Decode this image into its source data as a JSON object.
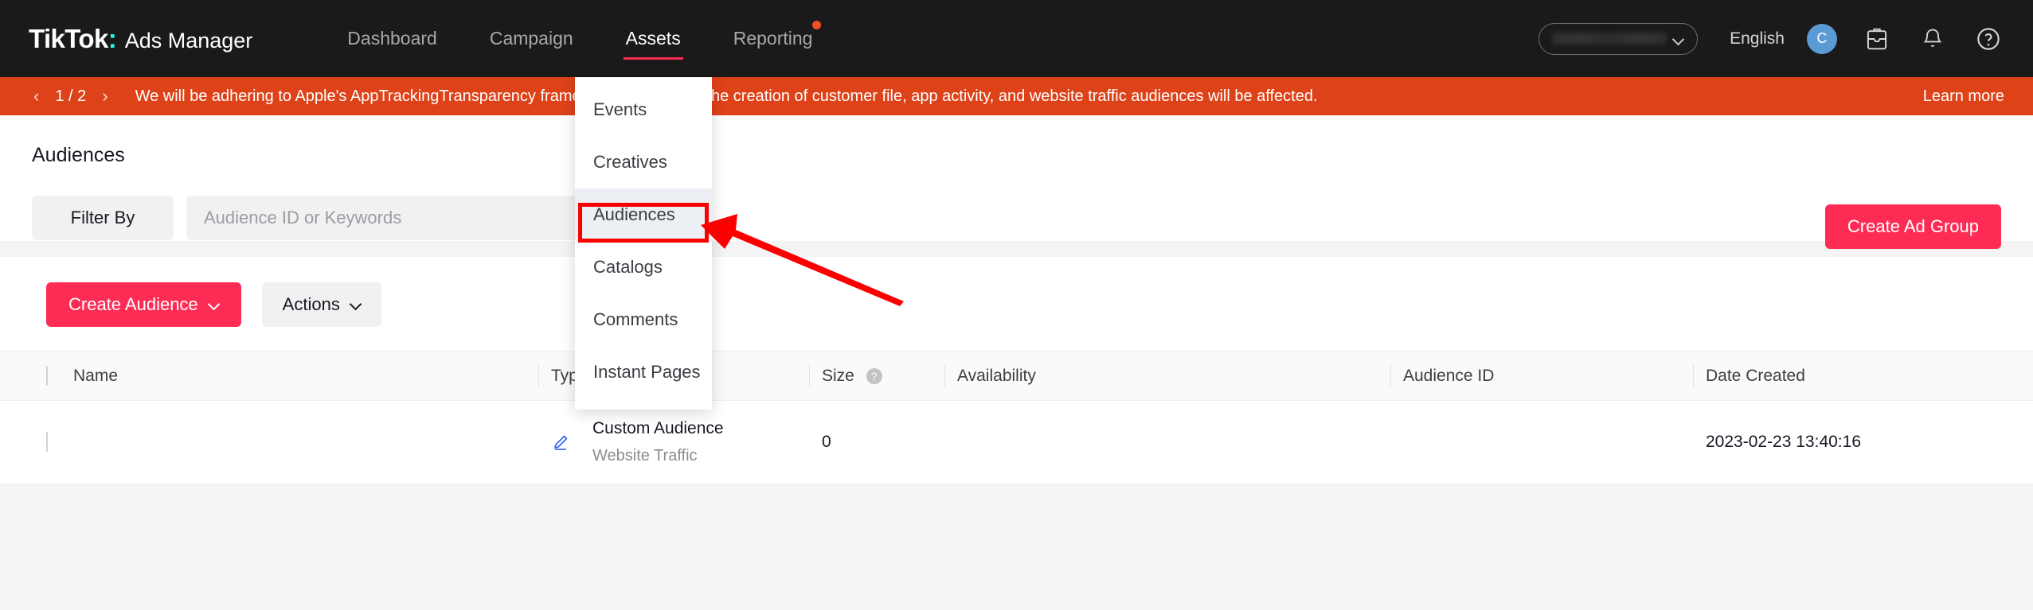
{
  "header": {
    "brand": {
      "tiktok": "TikTok",
      "colon": ":",
      "product": "Ads Manager"
    },
    "nav": [
      {
        "label": "Dashboard",
        "active": false,
        "dot": false
      },
      {
        "label": "Campaign",
        "active": false,
        "dot": false
      },
      {
        "label": "Assets",
        "active": true,
        "dot": false
      },
      {
        "label": "Reporting",
        "active": false,
        "dot": true
      }
    ],
    "account_selector": {
      "value": "",
      "icon": "chevron-down-icon"
    },
    "language": "English",
    "avatar_initial": "C",
    "icons": [
      "inbox-icon",
      "bell-icon",
      "help-circle-icon"
    ]
  },
  "banner": {
    "prev_icon": "‹",
    "page_indicator": "1 / 2",
    "next_icon": "›",
    "message": "We will be adhering to Apple's AppTrackingTransparency framework. As a result, the creation of customer file, app activity, and website traffic audiences will be affected.",
    "learn_more": "Learn more",
    "color": "#de4219"
  },
  "assets_menu": {
    "items": [
      {
        "label": "Events",
        "selected": false
      },
      {
        "label": "Creatives",
        "selected": false
      },
      {
        "label": "Audiences",
        "selected": true
      },
      {
        "label": "Catalogs",
        "selected": false
      },
      {
        "label": "Comments",
        "selected": false
      },
      {
        "label": "Instant Pages",
        "selected": false
      }
    ]
  },
  "page": {
    "title": "Audiences",
    "filter_by_label": "Filter By",
    "search": {
      "value": "",
      "placeholder": "Audience ID or Keywords"
    },
    "create_ad_group_label": "Create Ad Group",
    "create_audience_label": "Create Audience",
    "actions_label": "Actions"
  },
  "table": {
    "columns": [
      {
        "label": "Name",
        "help": false
      },
      {
        "label": "Type",
        "help": false
      },
      {
        "label": "Size",
        "help": true
      },
      {
        "label": "Availability",
        "help": false
      },
      {
        "label": "Audience ID",
        "help": false
      },
      {
        "label": "Date Created",
        "help": false
      }
    ],
    "rows": [
      {
        "name": "",
        "name_redacted": true,
        "edit_icon": "pencil-icon",
        "type": "Custom Audience",
        "type_sub": "Website Traffic",
        "size": "0",
        "availability": "",
        "availability_redacted": true,
        "audience_id": "",
        "audience_id_redacted": true,
        "date_created": "2023-02-23 13:40:16"
      }
    ]
  },
  "annotations": {
    "highlight_target": "Audiences",
    "arrow_color": "#fb0000",
    "box_color": "#fb0000"
  },
  "colors": {
    "brand_pink": "#fe2c55",
    "brand_cyan": "#25f4ee",
    "banner": "#de4219",
    "header_bg": "#1a1a1a",
    "link_blue": "#2e5ff4"
  }
}
